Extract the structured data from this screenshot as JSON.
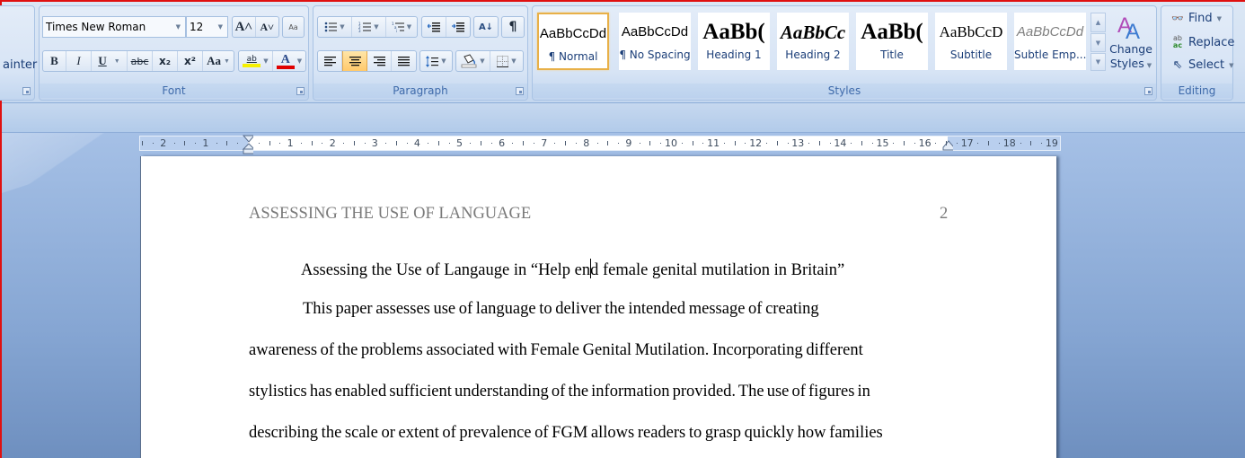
{
  "ribbon": {
    "clipboard": {
      "format_painter_label": "ainter"
    },
    "font": {
      "group_label": "Font",
      "font_name": "Times New Roman",
      "font_size": "12",
      "grow_font_icon": "A˄",
      "shrink_font_icon": "A˅",
      "clear_formatting_icon": "Aa",
      "bold": "B",
      "italic": "I",
      "underline": "U",
      "strikethrough": "abc",
      "subscript": "x₂",
      "superscript": "x²",
      "change_case": "Aa",
      "highlight": "ab",
      "font_color": "A",
      "highlight_color": "#f5f000",
      "font_color_value": "#e00000"
    },
    "paragraph": {
      "group_label": "Paragraph",
      "bullets_icon": "☰",
      "numbering_icon": "☰",
      "multilevel_icon": "☰",
      "sort_icon": "A↓",
      "show_marks": "¶"
    },
    "styles": {
      "group_label": "Styles",
      "tiles": [
        {
          "sample": "AaBbCcDd",
          "name": "¶ Normal",
          "selected": true
        },
        {
          "sample": "AaBbCcDd",
          "name": "¶ No Spacing",
          "selected": false
        },
        {
          "sample": "AaBb(",
          "name": "Heading 1",
          "selected": false
        },
        {
          "sample": "AaBbCc",
          "name": "Heading 2",
          "selected": false
        },
        {
          "sample": "AaBb(",
          "name": "Title",
          "selected": false
        },
        {
          "sample": "AaBbCcD",
          "name": "Subtitle",
          "selected": false
        },
        {
          "sample": "AaBbCcDd",
          "name": "Subtle Emp...",
          "selected": false
        }
      ],
      "change_styles_line1": "Change",
      "change_styles_line2": "Styles"
    },
    "editing": {
      "group_label": "Editing",
      "find": "Find",
      "replace": "Replace",
      "select": "Select"
    }
  },
  "ruler": {
    "left_numbers": [
      "2",
      "1"
    ],
    "right_numbers": [
      "1",
      "2",
      "3",
      "4",
      "5",
      "6",
      "7",
      "8",
      "9",
      "10",
      "11",
      "12",
      "13",
      "14",
      "15",
      "16",
      "17",
      "18",
      "19"
    ]
  },
  "document": {
    "header_title": "ASSESSING THE USE OF LANGUAGE",
    "page_number": "2",
    "title_before_caret": "Assessing the Use of Langauge in “Help en",
    "title_after_caret": "d female genital mutilation in Britain”",
    "lines": [
      "This paper assesses use of language to deliver the intended message of creating",
      "awareness of the problems associated with Female Genital Mutilation. Incorporating different",
      "stylistics has enabled sufficient understanding of the information provided. The use of figures in",
      "describing the scale or extent of prevalence of FGM allows readers to grasp quickly how families"
    ]
  }
}
